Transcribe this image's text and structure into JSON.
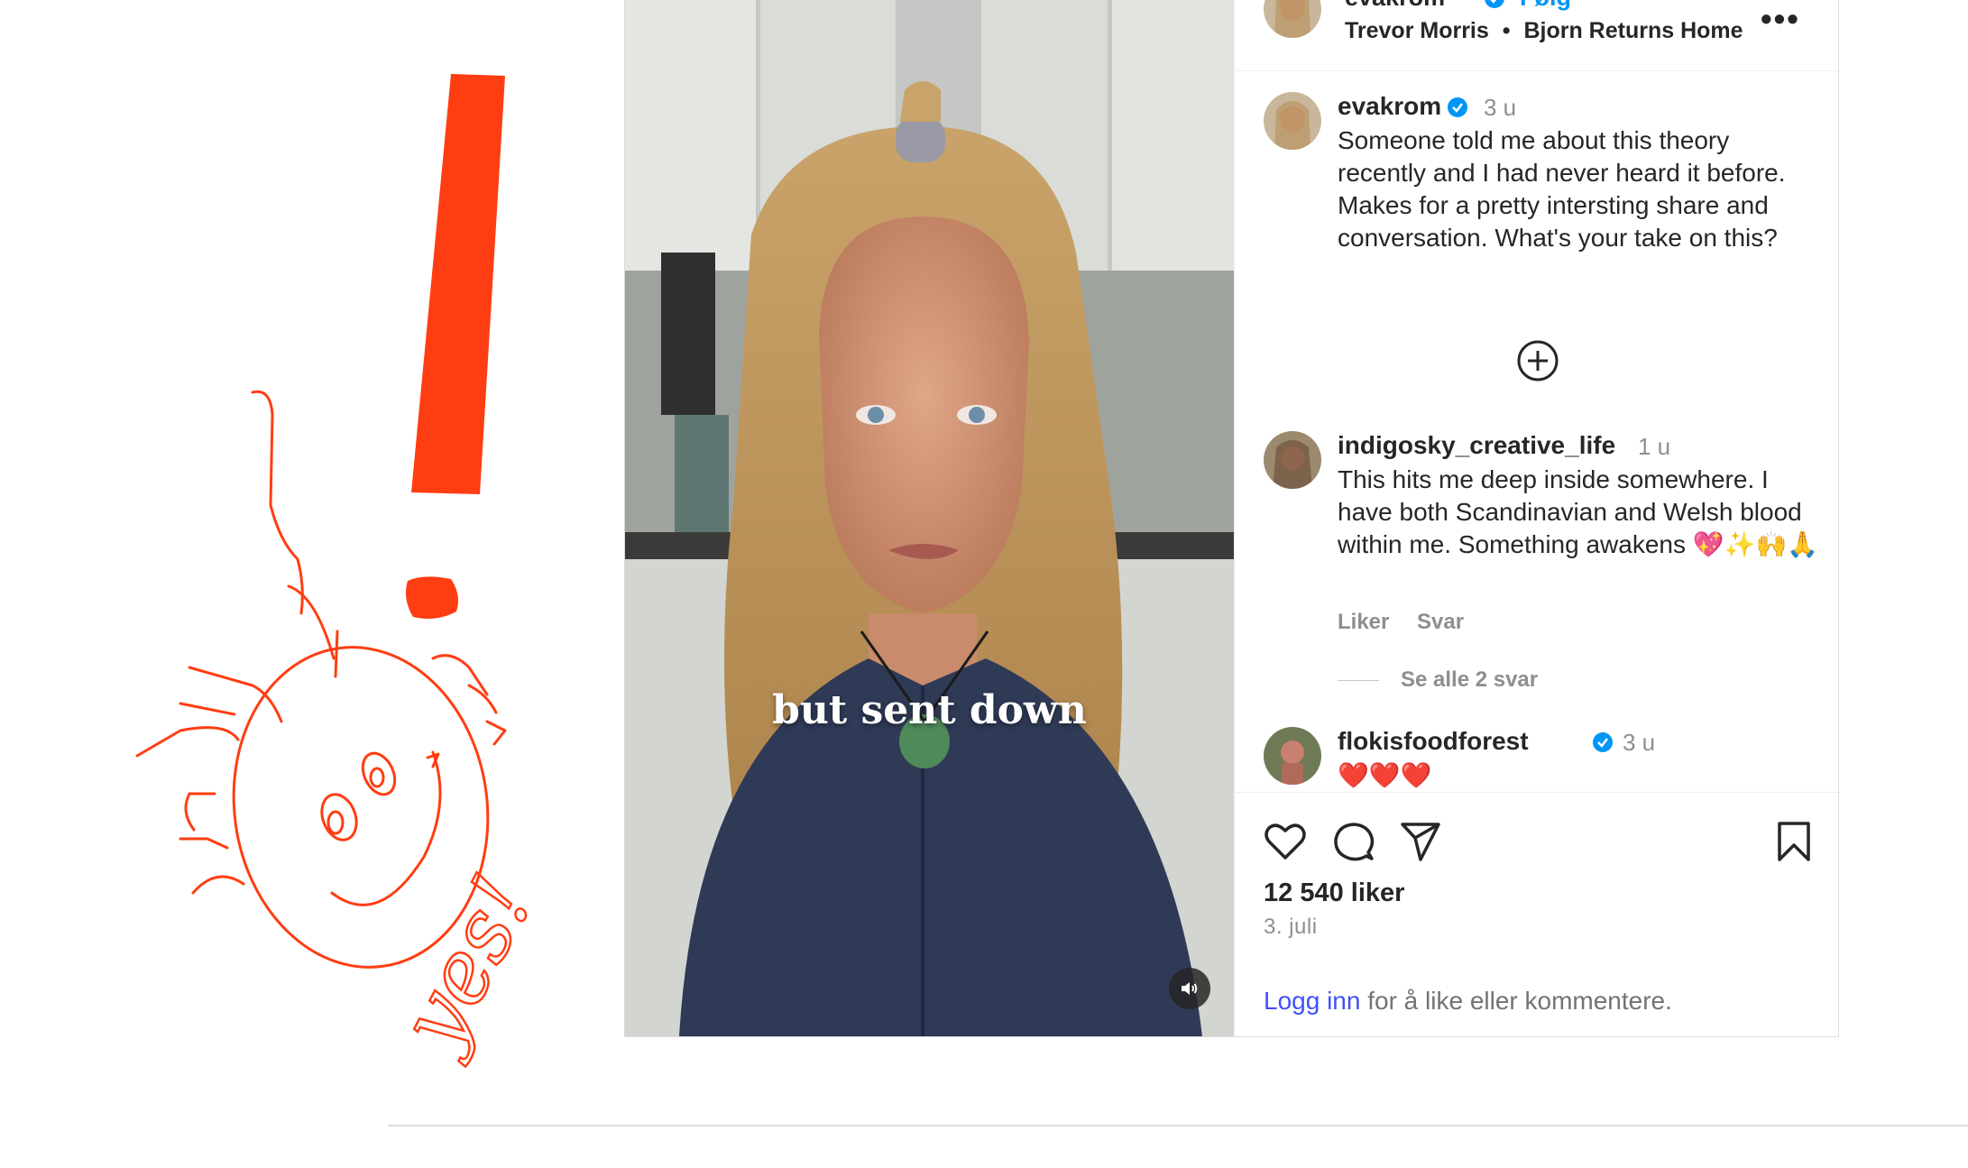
{
  "post": {
    "header": {
      "username": "evakrom",
      "follow_label": "Følg",
      "audio_artist": "Trevor Morris",
      "separator": "•",
      "audio_title": "Bjorn Returns Home",
      "more_label": "•••"
    },
    "video": {
      "caption": "but sent down",
      "audio_icon": "speaker-icon"
    },
    "comments": [
      {
        "username": "evakrom",
        "verified": true,
        "time": "3 u",
        "text": "Someone told me about this theory recently and I had never heard it before. Makes for a pretty intersting share and conversation. What's your take on this?"
      },
      {
        "username": "indigosky_creative_life",
        "verified": false,
        "time": "1 u",
        "text": "This hits me deep inside somewhere. I have both Scandinavian and Welsh blood within me. Something awakens 💖✨🙌🙏",
        "like_label": "Liker",
        "reply_label": "Svar",
        "view_replies": "Se alle 2 svar"
      },
      {
        "username": "flokisfoodforest",
        "verified": true,
        "time": "3 u",
        "text": "❤️❤️❤️"
      }
    ],
    "footer": {
      "likes": "12 540 liker",
      "date": "3. juli",
      "login_link": "Logg inn",
      "login_text": " for å like eller kommentere."
    }
  },
  "doodle": {
    "handwriting": "yes!",
    "color": "#ff3d12"
  },
  "colors": {
    "accent": "#0095f6",
    "link": "#4150f7",
    "verified": "#0095f6",
    "muted": "#8e8e8e"
  }
}
